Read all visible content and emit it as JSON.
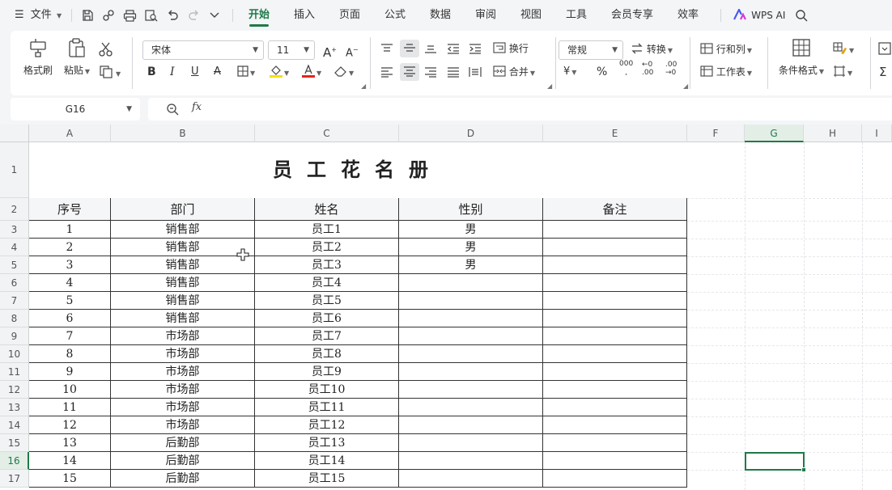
{
  "menubar": {
    "menu_icon": "hamburger-icon",
    "file_label": "文件",
    "tabs": [
      "开始",
      "插入",
      "页面",
      "公式",
      "数据",
      "审阅",
      "视图",
      "工具",
      "会员专享",
      "效率"
    ],
    "active_tab": "开始",
    "wps_ai_label": "WPS AI",
    "accent": "#1f7a49"
  },
  "ribbon": {
    "format_painter": "格式刷",
    "paste": "粘贴",
    "font_name": "宋体",
    "font_size": "11",
    "wrap_text": "换行",
    "merge": "合并",
    "number_format": "常规",
    "convert": "转换",
    "rows_cols": "行和列",
    "worksheet": "工作表",
    "conditional_format": "条件格式",
    "currency_symbol": "¥",
    "percent_symbol": "%",
    "thousands_symbol": "000",
    "font_color": "#e0261b",
    "highlight_color": "#f4e100"
  },
  "formula_bar": {
    "cell_ref": "G16",
    "fx_label": "fx",
    "formula": ""
  },
  "sheet": {
    "columns": [
      "A",
      "B",
      "C",
      "D",
      "E",
      "F",
      "G",
      "H",
      "I"
    ],
    "rows": [
      "1",
      "2",
      "3",
      "4",
      "5",
      "6",
      "7",
      "8",
      "9",
      "10",
      "11",
      "12",
      "13",
      "14",
      "15",
      "16",
      "17"
    ],
    "selected_col": "G",
    "selected_row": "16",
    "title": "员工花名册",
    "headers": [
      "序号",
      "部门",
      "姓名",
      "性别",
      "备注"
    ],
    "data": [
      [
        "1",
        "销售部",
        "员工1",
        "男",
        ""
      ],
      [
        "2",
        "销售部",
        "员工2",
        "男",
        ""
      ],
      [
        "3",
        "销售部",
        "员工3",
        "男",
        ""
      ],
      [
        "4",
        "销售部",
        "员工4",
        "",
        ""
      ],
      [
        "5",
        "销售部",
        "员工5",
        "",
        ""
      ],
      [
        "6",
        "销售部",
        "员工6",
        "",
        ""
      ],
      [
        "7",
        "市场部",
        "员工7",
        "",
        ""
      ],
      [
        "8",
        "市场部",
        "员工8",
        "",
        ""
      ],
      [
        "9",
        "市场部",
        "员工9",
        "",
        ""
      ],
      [
        "10",
        "市场部",
        "员工10",
        "",
        ""
      ],
      [
        "11",
        "市场部",
        "员工11",
        "",
        ""
      ],
      [
        "12",
        "市场部",
        "员工12",
        "",
        ""
      ],
      [
        "13",
        "后勤部",
        "员工13",
        "",
        ""
      ],
      [
        "14",
        "后勤部",
        "员工14",
        "",
        ""
      ],
      [
        "15",
        "后勤部",
        "员工15",
        "",
        ""
      ]
    ]
  }
}
